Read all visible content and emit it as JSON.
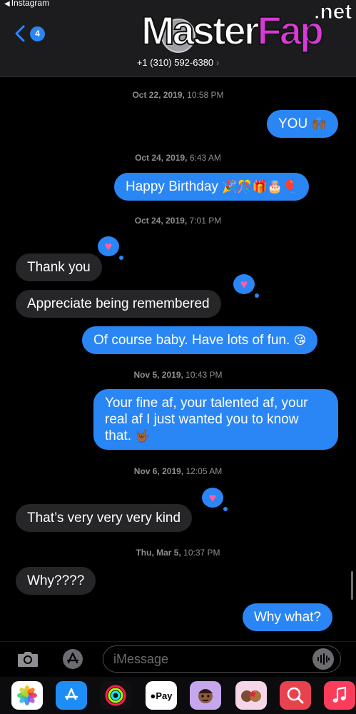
{
  "status": {
    "back_app": "Instagram"
  },
  "header": {
    "unread_count": "4",
    "contact_number": "+1 (310) 592-6380"
  },
  "watermark": {
    "main": "Master",
    "accent": "Fap",
    "suffix": ".net"
  },
  "messages": [
    {
      "timestamp": {
        "date": "Oct 22, 2019,",
        "time": "10:58 PM"
      }
    },
    {
      "text": "YOU",
      "emoji": "🙌🏾",
      "direction": "out"
    },
    {
      "timestamp": {
        "date": "Oct 24, 2019,",
        "time": "6:43 AM"
      }
    },
    {
      "text": "Happy Birthday",
      "emoji": "🎉🎊🎁🎂🎈",
      "direction": "out"
    },
    {
      "timestamp": {
        "date": "Oct 24, 2019,",
        "time": "7:01 PM"
      }
    },
    {
      "text": "Thank you",
      "direction": "in",
      "tapback": "heart"
    },
    {
      "text": "Appreciate being remembered",
      "direction": "in",
      "tapback": "heart"
    },
    {
      "text": "Of course baby. Have lots of fun.",
      "emoji": "😘",
      "direction": "out"
    },
    {
      "timestamp": {
        "date": "Nov 5, 2019,",
        "time": "10:43 PM"
      }
    },
    {
      "text": "Your fine af, your talented af, your real af I just wanted you to know that.",
      "emoji": "🤟🏾",
      "direction": "out"
    },
    {
      "timestamp": {
        "date": "Nov 6, 2019,",
        "time": "12:05 AM"
      }
    },
    {
      "text": "That’s very very very kind",
      "direction": "in",
      "tapback": "heart"
    },
    {
      "timestamp": {
        "date": "Thu, Mar 5,",
        "time": "10:37 PM"
      }
    },
    {
      "text": "Why????",
      "direction": "in"
    },
    {
      "text": "Why what?",
      "direction": "out"
    }
  ],
  "input": {
    "placeholder": "iMessage"
  },
  "drawer": {
    "apple_pay_label": "Pay",
    "apps": [
      "photos-icon",
      "app-store-icon",
      "activity-icon",
      "apple-pay-icon",
      "memoji-icon",
      "memoji-icon",
      "web-search-icon",
      "music-icon"
    ]
  },
  "colors": {
    "outgoing": "#2a86f5",
    "incoming": "#262629",
    "heart": "#ff5fa2"
  }
}
